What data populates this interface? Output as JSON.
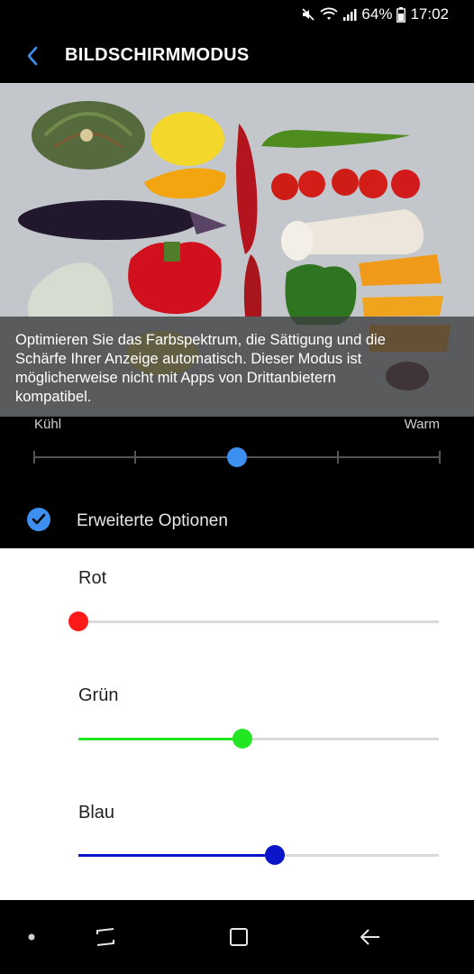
{
  "status_bar": {
    "battery": "64%",
    "time": "17:02",
    "icons": [
      "mute-icon",
      "wifi-icon",
      "signal-icon",
      "battery-icon"
    ]
  },
  "header": {
    "title": "BILDSCHIRMMODUS",
    "back_icon": "chevron-left-icon",
    "accent_color": "#3d8ff0"
  },
  "preview": {
    "image": "vegetables-photo",
    "caption": "Optimieren Sie das Farbspektrum, die Sättigung und die Schärfe Ihrer Anzeige automatisch. Dieser Modus ist möglicherweise nicht mit Apps von Drittanbietern kompatibel."
  },
  "color_temperature": {
    "left_label": "Kühl",
    "right_label": "Warm",
    "steps": 5,
    "selected_step": 3
  },
  "advanced_options": {
    "label": "Erweiterte Optionen",
    "checked": true
  },
  "rgb_sliders": [
    {
      "label": "Rot",
      "value": 0.0,
      "color": "#ff1a1a"
    },
    {
      "label": "Grün",
      "value": 0.455,
      "color": "#22e622"
    },
    {
      "label": "Blau",
      "value": 0.545,
      "color": "#0a14c8"
    }
  ],
  "nav_bar": {
    "buttons": [
      "dot-icon",
      "recent-apps-icon",
      "home-icon",
      "back-icon"
    ]
  }
}
